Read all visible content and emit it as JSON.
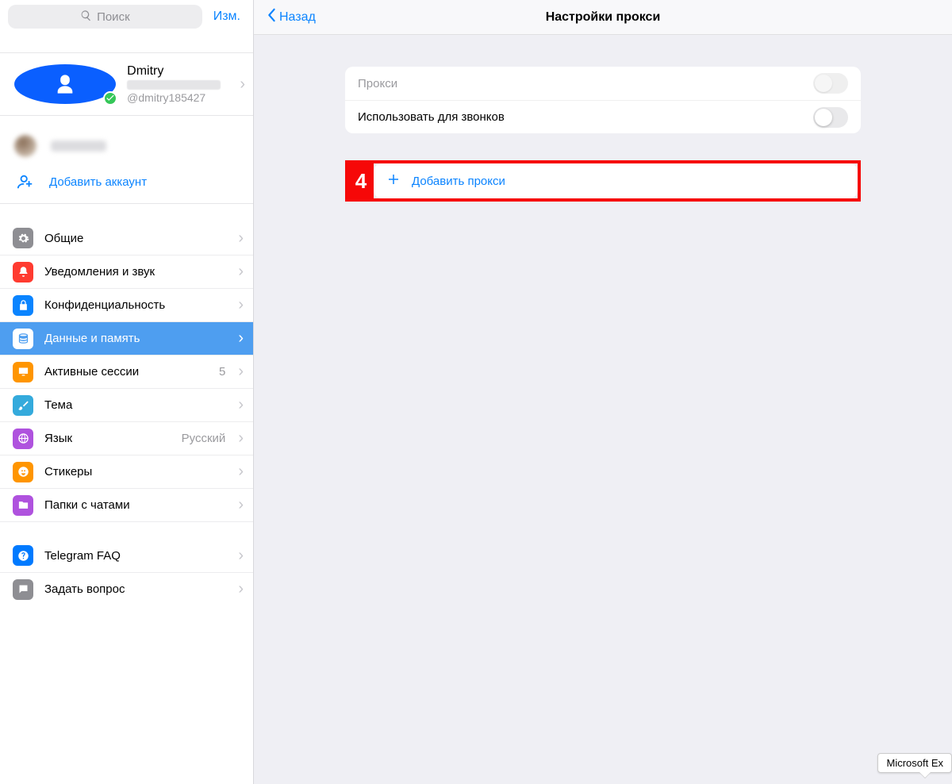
{
  "sidebar": {
    "search_placeholder": "Поиск",
    "edit_label": "Изм.",
    "profile": {
      "name": "Dmitry",
      "handle": "@dmitry185427"
    },
    "add_account_label": "Добавить аккаунт",
    "items": {
      "general": {
        "label": "Общие"
      },
      "notif": {
        "label": "Уведомления и звук"
      },
      "privacy": {
        "label": "Конфиденциальность"
      },
      "data": {
        "label": "Данные и память"
      },
      "sessions": {
        "label": "Активные сессии",
        "detail": "5"
      },
      "theme": {
        "label": "Тема"
      },
      "language": {
        "label": "Язык",
        "detail": "Русский"
      },
      "stickers": {
        "label": "Стикеры"
      },
      "folders": {
        "label": "Папки с чатами"
      },
      "faq": {
        "label": "Telegram FAQ"
      },
      "ask": {
        "label": "Задать вопрос"
      }
    }
  },
  "main": {
    "back_label": "Назад",
    "title": "Настройки прокси",
    "proxy_row_label": "Прокси",
    "calls_row_label": "Использовать для звонков",
    "add_proxy_label": "Добавить прокси"
  },
  "annotation": {
    "num": "4"
  },
  "tooltip": {
    "text": "Microsoft Ex"
  }
}
